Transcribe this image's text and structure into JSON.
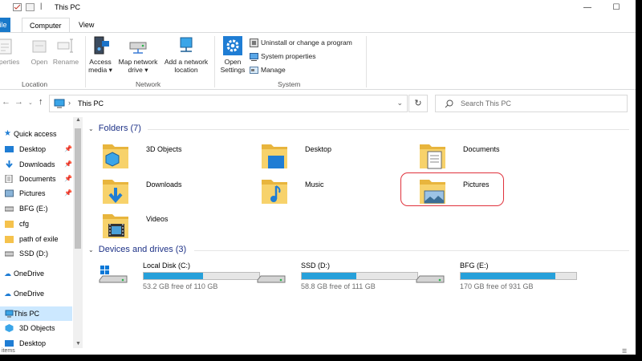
{
  "window": {
    "title": "This PC"
  },
  "ribbon_tabs": {
    "file": "File",
    "computer": "Computer",
    "view": "View"
  },
  "ribbon": {
    "location": {
      "properties": "Properties",
      "open": "Open",
      "rename": "Rename",
      "group": "Location"
    },
    "network": {
      "access_media_1": "Access",
      "access_media_2": "media ▾",
      "map_drive_1": "Map network",
      "map_drive_2": "drive ▾",
      "add_location_1": "Add a network",
      "add_location_2": "location",
      "group": "Network"
    },
    "system": {
      "open_settings_1": "Open",
      "open_settings_2": "Settings",
      "uninstall": "Uninstall or change a program",
      "system_properties": "System properties",
      "manage": "Manage",
      "group": "System"
    }
  },
  "address": {
    "path": "This PC",
    "search_placeholder": "Search This PC"
  },
  "nav_pane": {
    "items": [
      {
        "label": "Quick access",
        "icon": "star-icon"
      },
      {
        "label": "Desktop",
        "icon": "desktop-folder-icon",
        "pinned": true
      },
      {
        "label": "Downloads",
        "icon": "downloads-folder-icon",
        "pinned": true
      },
      {
        "label": "Documents",
        "icon": "documents-folder-icon",
        "pinned": true
      },
      {
        "label": "Pictures",
        "icon": "pictures-folder-icon",
        "pinned": true
      },
      {
        "label": "BFG (E:)",
        "icon": "drive-icon"
      },
      {
        "label": "cfg",
        "icon": "folder-icon"
      },
      {
        "label": "path of exile",
        "icon": "folder-icon"
      },
      {
        "label": "SSD (D:)",
        "icon": "drive-icon"
      },
      {
        "label": "OneDrive",
        "icon": "cloud-icon"
      },
      {
        "label": "OneDrive",
        "icon": "cloud-icon"
      },
      {
        "label": "This PC",
        "icon": "computer-icon",
        "selected": true
      },
      {
        "label": "3D Objects",
        "icon": "3d-objects-icon"
      },
      {
        "label": "Desktop",
        "icon": "desktop-folder-icon"
      }
    ]
  },
  "folders": {
    "heading": "Folders (7)",
    "items": [
      {
        "name": "3D Objects",
        "icon": "3d-objects-folder-icon"
      },
      {
        "name": "Desktop",
        "icon": "desktop-folder-icon"
      },
      {
        "name": "Documents",
        "icon": "documents-folder-icon"
      },
      {
        "name": "Downloads",
        "icon": "downloads-folder-icon"
      },
      {
        "name": "Music",
        "icon": "music-folder-icon"
      },
      {
        "name": "Pictures",
        "icon": "pictures-folder-icon",
        "highlighted": true
      },
      {
        "name": "Videos",
        "icon": "videos-folder-icon"
      }
    ]
  },
  "drives": {
    "heading": "Devices and drives (3)",
    "items": [
      {
        "name": "Local Disk (C:)",
        "free": "53.2 GB free of 110 GB",
        "used_fraction": 0.516
      },
      {
        "name": "SSD (D:)",
        "free": "58.8 GB free of 111 GB",
        "used_fraction": 0.47
      },
      {
        "name": "BFG (E:)",
        "free": "170 GB free of 931 GB",
        "used_fraction": 0.817
      }
    ]
  },
  "status": {
    "items_text": "items"
  },
  "colors": {
    "accent": "#1979ca",
    "progress": "#26a0da",
    "highlight": "#e0323c",
    "heading": "#1e3287",
    "selected": "#cce8ff"
  }
}
